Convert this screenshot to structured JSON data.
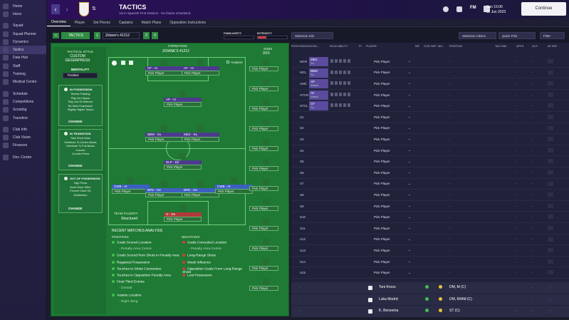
{
  "sidebar": [
    "Home",
    "Inbox",
    "Squad",
    "Squad Planner",
    "Dynamics",
    "Tactics",
    "Data Hub",
    "Staff",
    "Training",
    "Medical Centre",
    "Schedule",
    "Competitions",
    "Scouting",
    "Transfers",
    "Club Info",
    "Club Vision",
    "Finances",
    "Dev. Centre"
  ],
  "header": {
    "title": "TACTICS",
    "subtitle": "1st in Spanish First Division · No fixture scheduled.",
    "date_day": "Sun 15:00",
    "date": "11 Jun 2023",
    "continue": "Continue"
  },
  "tabs": [
    "Overview",
    "Player",
    "Set Pieces",
    "Captains",
    "Match Plans",
    "Opposition Instructions"
  ],
  "toolbar": {
    "tactic_label": "TACTICS",
    "tactic1": "1",
    "tactic_name": "Zidane's 41212",
    "tactic2": "2",
    "tactic3": "3",
    "familiarity": "FAMILIARITY",
    "intensity": "INTENSITY",
    "selection_info": "Selection Info",
    "selection_advice": "Selection Advice",
    "quick_pick": "Quick Pick",
    "filter": "Filter"
  },
  "style": {
    "title": "TACTICAL STYLE",
    "value": "CUSTOM GEGENPRESS",
    "mentality_label": "MENTALITY",
    "mentality": "Positive",
    "in_possession": "IN POSSESSION",
    "in_possession_items": [
      "Shorter Passing",
      "Play Into Space",
      "Play Out Of Defence",
      "Be More Expressive",
      "Slightly Higher Tempo"
    ],
    "in_transition": "IN TRANSITION",
    "in_transition_items": [
      "Take Short Kicks",
      "Distribute To Centre-Backs",
      "Distribute To Full-Backs",
      "Counter",
      "Counter-Press"
    ],
    "out_possession": "OUT OF POSSESSION",
    "out_possession_items": [
      "High Press",
      "Much More Often",
      "Prevent Short GK",
      "Distribution"
    ],
    "change": "CHANGE"
  },
  "formation": {
    "label": "FORMATION",
    "name": "ZIDANE'S 41212",
    "subs_label": "SUBS",
    "subs": "0/15",
    "analysis": "Analysis",
    "fluidity_label": "TEAM FLUIDITY",
    "fluidity": "Structured"
  },
  "pitch_players": [
    {
      "role": "CF - At",
      "pick": "Pick Player"
    },
    {
      "role": "AF - At",
      "pick": "Pick Player"
    },
    {
      "role": "AP - At",
      "pick": "Pick Player"
    },
    {
      "role": "BBM - Su",
      "pick": "Pick Player"
    },
    {
      "role": "MEZ - Su",
      "pick": "Pick Player"
    },
    {
      "role": "DLP - De",
      "pick": "Pick Player"
    },
    {
      "role": "CWB - At",
      "pick": "Pick Player"
    },
    {
      "role": "BPD - De",
      "pick": "Pick Player"
    },
    {
      "role": "BPD - De",
      "pick": "Pick Player"
    },
    {
      "role": "CWB - At",
      "pick": "Pick Player"
    },
    {
      "role": "G - De",
      "pick": "Pick Player"
    }
  ],
  "sub_picks": [
    "Pick Player",
    "Pick Player",
    "Pick Player",
    "Pick Player",
    "Pick Player",
    "Pick Player",
    "Pick Player",
    "Pick Player",
    "Pick Player",
    "Pick Player",
    "Pick Player",
    "Pick Player",
    "Pick Player",
    "Pick Player",
    "Pick Player",
    "Pick Player",
    "Pick Player",
    "Pick Player",
    "Pick Player",
    "Pick Player",
    "Pick Player",
    "Pick Player",
    "Pick Player"
  ],
  "analysis": {
    "title": "RECENT MATCHES ANALYSIS",
    "positives_label": "POSITIVES",
    "negatives_label": "NEGATIVES",
    "positives": [
      "Goals Scored Location",
      "- Penalty Area Centre",
      "Goals Scored from Shots In Penalty Area",
      "Regained Possession",
      "Touches to Shots Conversion",
      "Touches in Opposition Penalty Area",
      "Final Third Entries",
      "- Central",
      "Assists Location",
      "- Right Wing"
    ],
    "negatives": [
      "Goals Conceded Location",
      "- Penalty Area Centre",
      "Long-Range Shots",
      "Weak Influence",
      "Opposition Goals From Long-Range Shots",
      "Lost Possession"
    ]
  },
  "table": {
    "headers": [
      "POSITION/ROLE/DU...",
      "ROLE ABILITY",
      "PI",
      "PLAYER",
      "INF",
      "CON",
      "SHP",
      "MO...",
      "POSITION",
      "TAC FAM",
      "APPS",
      "GLS",
      "AV RAT"
    ],
    "rows": [
      {
        "pos": "MCR",
        "role": "MEZ",
        "duty": "Su",
        "player": "Pick Player"
      },
      {
        "pos": "MCL",
        "role": "BBM",
        "duty": "Su",
        "player": "Pick Player"
      },
      {
        "pos": "AMC",
        "role": "AP",
        "duty": "Attack",
        "player": "Pick Player"
      },
      {
        "pos": "STCR",
        "role": "AF",
        "duty": "Attack",
        "player": "Pick Player"
      },
      {
        "pos": "STCL",
        "role": "CF",
        "duty": "Su",
        "player": "Pick Player"
      },
      {
        "pos": "S1",
        "player": "Pick Player"
      },
      {
        "pos": "S2",
        "player": "Pick Player"
      },
      {
        "pos": "S3",
        "player": "Pick Player"
      },
      {
        "pos": "S4",
        "player": "Pick Player"
      },
      {
        "pos": "S5",
        "player": "Pick Player"
      },
      {
        "pos": "S6",
        "player": "Pick Player"
      },
      {
        "pos": "S7",
        "player": "Pick Player"
      },
      {
        "pos": "S8",
        "player": "Pick Player"
      },
      {
        "pos": "S9",
        "player": "Pick Player"
      },
      {
        "pos": "S10",
        "player": "Pick Player"
      },
      {
        "pos": "S11",
        "player": "Pick Player"
      },
      {
        "pos": "S12",
        "player": "Pick Player"
      },
      {
        "pos": "S13",
        "player": "Pick Player"
      },
      {
        "pos": "S14",
        "player": "Pick Player"
      },
      {
        "pos": "S15",
        "player": "Pick Player"
      }
    ],
    "players": [
      {
        "name": "Toni Kroos",
        "position": "DM, M (C)"
      },
      {
        "name": "Luka Modrić",
        "position": "DM, M/AM (C)"
      },
      {
        "name": "K. Benzema",
        "position": "ST (C)"
      }
    ],
    "dash": "-"
  }
}
